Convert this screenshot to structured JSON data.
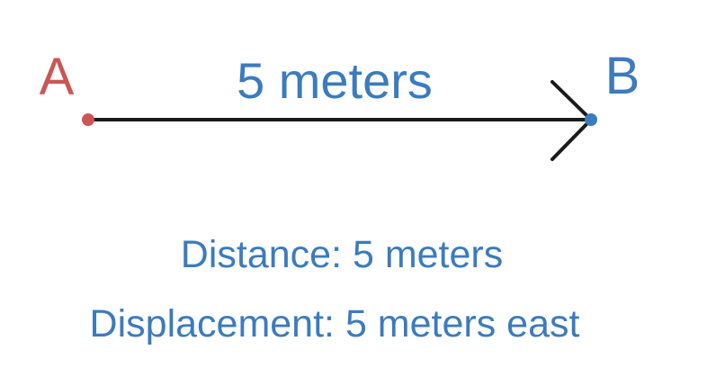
{
  "points": {
    "start": {
      "label": "A",
      "color": "#cc5555"
    },
    "end": {
      "label": "B",
      "color": "#3b7bbf"
    }
  },
  "arrow": {
    "label": "5 meters",
    "label_color": "#3b7bbf",
    "line_color": "#1a1a1a"
  },
  "info": {
    "distance": "Distance: 5 meters",
    "displacement": "Displacement: 5 meters east",
    "color": "#3b7bbf"
  }
}
